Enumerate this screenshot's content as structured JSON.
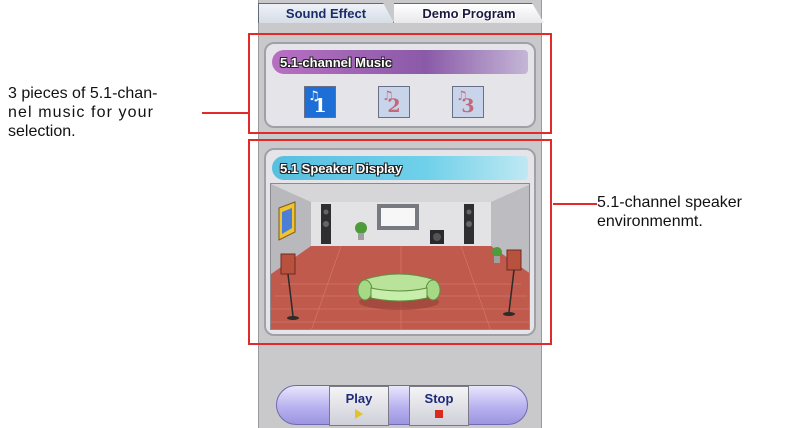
{
  "tabs": [
    {
      "label": "Sound Effect",
      "active": false
    },
    {
      "label": "Demo Program",
      "active": true
    }
  ],
  "music_section": {
    "title": "5.1-channel  Music",
    "buttons": [
      {
        "number": "1",
        "selected": true
      },
      {
        "number": "2",
        "selected": false
      },
      {
        "number": "3",
        "selected": false
      }
    ]
  },
  "speaker_section": {
    "title": "5.1 Speaker  Display"
  },
  "controls": {
    "play_label": "Play",
    "stop_label": "Stop"
  },
  "annotations": {
    "left_lines": [
      "3 pieces of 5.1-chan-",
      "nel music for your",
      "selection."
    ],
    "right_lines": [
      "5.1-channel speaker",
      "environmenmt."
    ]
  },
  "colors": {
    "highlight_box": "#e12a2a",
    "music_header": "#9c62b4",
    "speaker_header": "#5fc6e4",
    "play_bar": "#b8b2ef"
  }
}
